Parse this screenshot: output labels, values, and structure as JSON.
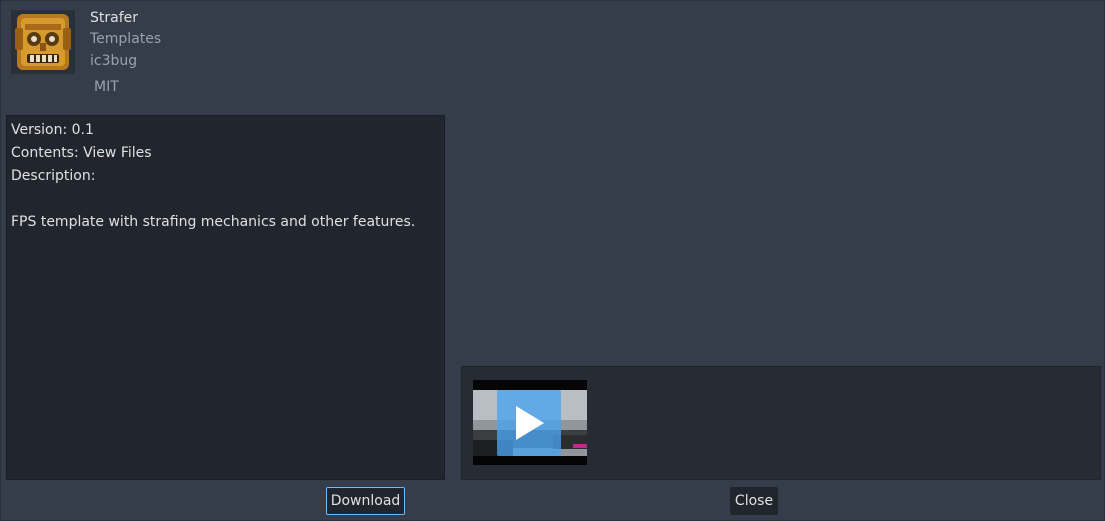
{
  "asset": {
    "title": "Strafer",
    "category": "Templates",
    "author": "ic3bug",
    "license": "MIT",
    "icon": "tiki-mask-icon"
  },
  "details": {
    "version": "Version: 0.1",
    "contents_prefix": "Contents: ",
    "contents_link": "View Files",
    "description_label": "Description:",
    "description": "FPS template with strafing mechanics and other features."
  },
  "preview": {
    "thumbnail_icon": "play-icon"
  },
  "buttons": {
    "download": "Download",
    "close": "Close"
  },
  "colors": {
    "background": "#363d4a",
    "panel": "#21262e",
    "accent": "#70bafa"
  }
}
